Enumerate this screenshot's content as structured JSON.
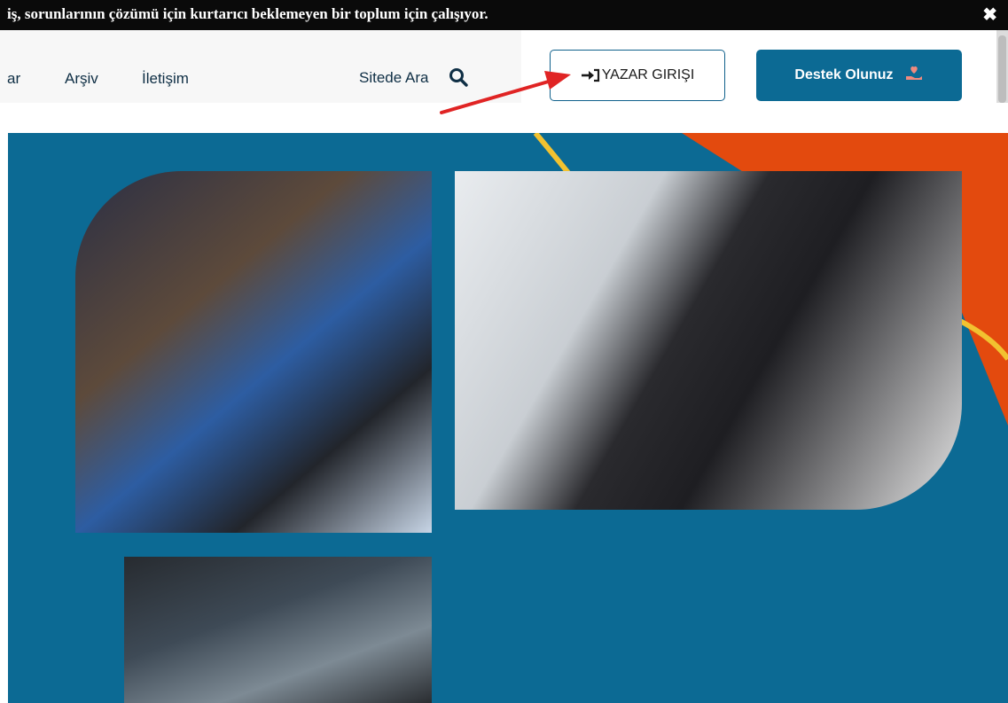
{
  "announcement": {
    "text": "iş, sorunlarının çözümü için kurtarıcı beklemeyen bir toplum için çalışıyor.",
    "close_icon": "close-icon"
  },
  "nav": {
    "items": [
      {
        "label": "ar"
      },
      {
        "label": "Arşiv"
      },
      {
        "label": "İletişim"
      }
    ],
    "search_label": "Sitede Ara",
    "search_icon": "search-icon"
  },
  "buttons": {
    "yazar_label": "YAZAR GIRIŞI",
    "yazar_icon": "login-icon",
    "destek_label": "Destek Olunuz",
    "destek_icon": "donate-hand-heart-icon"
  },
  "colors": {
    "hero_blue": "#0c6a94",
    "accent_orange": "#e34a0e",
    "accent_yellow": "#f2c230",
    "arrow_red": "#e02424"
  }
}
